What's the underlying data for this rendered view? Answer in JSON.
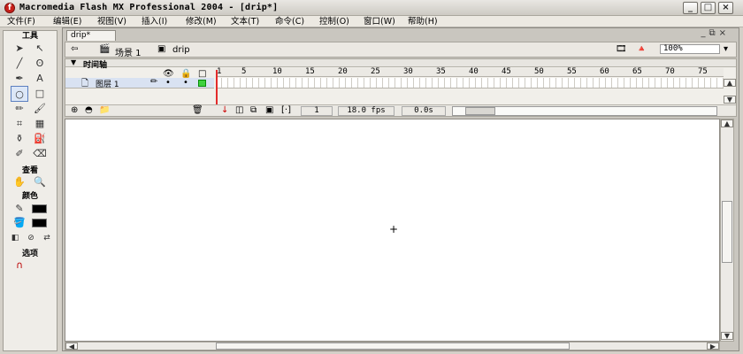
{
  "window": {
    "title": "Macromedia Flash MX Professional 2004 - [drip*]"
  },
  "menu": [
    "文件(F)",
    "编辑(E)",
    "视图(V)",
    "插入(I)",
    "修改(M)",
    "文本(T)",
    "命令(C)",
    "控制(O)",
    "窗口(W)",
    "帮助(H)"
  ],
  "tools": {
    "title": "工具",
    "view_label": "查看",
    "color_label": "颜色",
    "options_label": "选项"
  },
  "document": {
    "tab": "drip*",
    "scene": "场景 1",
    "symbol": "drip",
    "zoom": "100%"
  },
  "timeline": {
    "title": "时间轴",
    "layer": "图层 1",
    "frame_numbers": [
      "1",
      "5",
      "10",
      "15",
      "20",
      "25",
      "30",
      "35",
      "40",
      "45",
      "50",
      "55",
      "60",
      "65",
      "70",
      "75"
    ],
    "current_frame": "1",
    "fps": "18.0 fps",
    "elapsed": "0.0s"
  }
}
